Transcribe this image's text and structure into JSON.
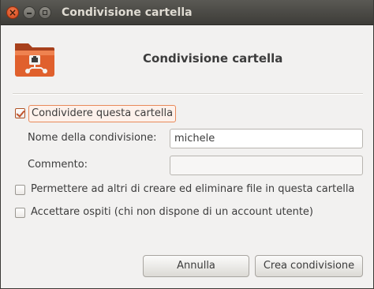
{
  "window": {
    "title": "Condivisione cartella"
  },
  "titlebar_buttons": {
    "close_glyph": "×"
  },
  "header": {
    "title": "Condivisione cartella",
    "icon": "shared-folder-icon"
  },
  "share": {
    "checkbox_label": "Condividere questa cartella",
    "checked": true
  },
  "fields": {
    "share_name_label": "Nome della condivisione:",
    "share_name_value": "michele",
    "comment_label": "Commento:",
    "comment_value": ""
  },
  "options": {
    "allow_others_label": "Permettere ad altri di creare ed eliminare file in questa cartella",
    "allow_others_checked": false,
    "guest_access_label": "Accettare ospiti (chi non dispone di un account utente)",
    "guest_access_checked": false
  },
  "buttons": {
    "cancel_label": "Annulla",
    "create_label": "Crea condivisione"
  },
  "colors": {
    "accent": "#dd4814",
    "titlebar": "#3c3b37"
  }
}
